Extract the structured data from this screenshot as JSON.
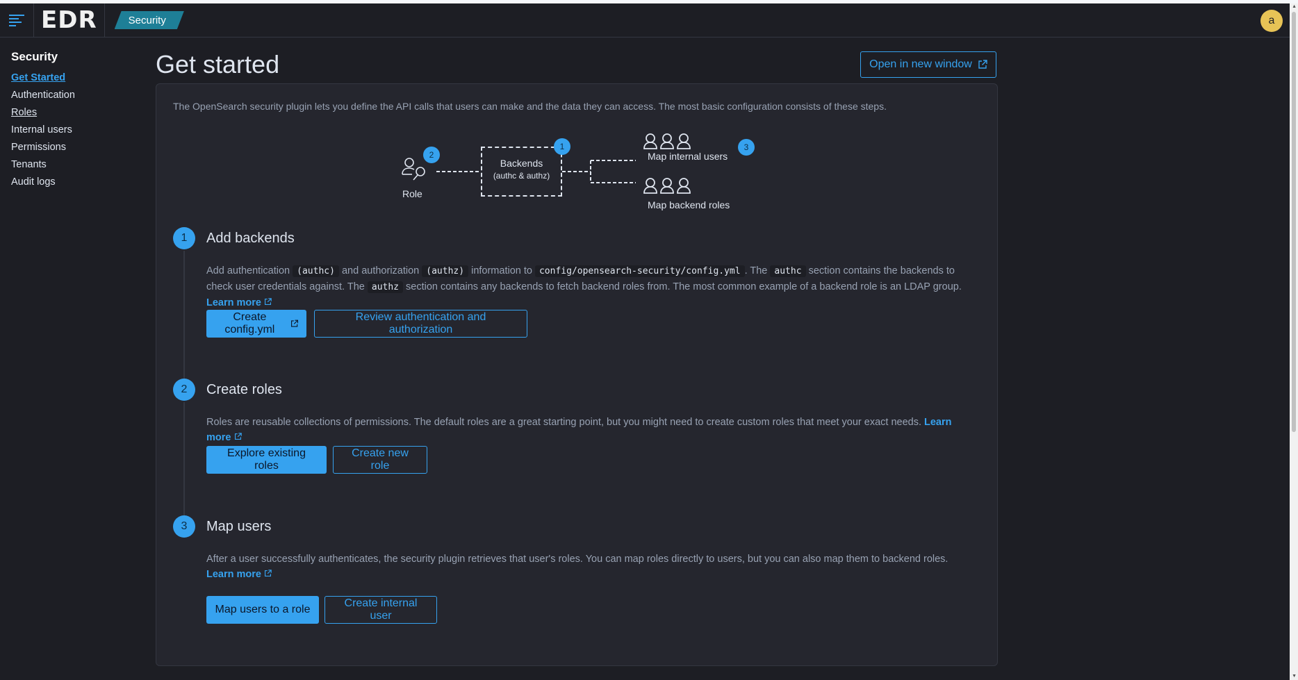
{
  "header": {
    "logo": "EDR",
    "breadcrumb": "Security",
    "avatar_initial": "a"
  },
  "sidebar": {
    "title": "Security",
    "items": [
      {
        "label": "Get Started"
      },
      {
        "label": "Authentication"
      },
      {
        "label": "Roles"
      },
      {
        "label": "Internal users"
      },
      {
        "label": "Permissions"
      },
      {
        "label": "Tenants"
      },
      {
        "label": "Audit logs"
      }
    ]
  },
  "main": {
    "title": "Get started",
    "open_window_label": "Open in new window",
    "intro": "The OpenSearch security plugin lets you define the API calls that users can make and the data they can access. The most basic configuration consists of these steps."
  },
  "diagram": {
    "role_label": "Role",
    "role_badge": "2",
    "backends_label": "Backends",
    "backends_sub": "(authc & authz)",
    "backends_badge": "1",
    "map_internal_label": "Map internal users",
    "map_badge": "3",
    "map_backend_label": "Map backend roles"
  },
  "steps": [
    {
      "number": "1",
      "title": "Add backends",
      "text": {
        "p1": "Add authentication",
        "c1": "(authc)",
        "p2": "and authorization",
        "c2": "(authz)",
        "p3": "information to",
        "c3": "config/opensearch-security/config.yml",
        "p4": ". The",
        "c4": "authc",
        "p5": "section contains the backends to check user credentials against. The",
        "c5": "authz",
        "p6": "section contains any backends to fetch backend roles from. The most common example of a backend role is an LDAP group.",
        "learn": "Learn more"
      },
      "primary": "Create config.yml",
      "secondary": "Review authentication and authorization"
    },
    {
      "number": "2",
      "title": "Create roles",
      "text": "Roles are reusable collections of permissions. The default roles are a great starting point, but you might need to create custom roles that meet your exact needs.",
      "learn": "Learn more",
      "primary": "Explore existing roles",
      "secondary": "Create new role"
    },
    {
      "number": "3",
      "title": "Map users",
      "text": "After a user successfully authenticates, the security plugin retrieves that user's roles. You can map roles directly to users, but you can also map them to backend roles.",
      "learn": "Learn more",
      "primary": "Map users to a role",
      "secondary": "Create internal user"
    }
  ],
  "colors": {
    "accent": "#36a2ef",
    "background": "#1d1e24",
    "panel": "#25262e",
    "breadcrumb": "#1e7f97",
    "avatar": "#e7c356"
  },
  "icons": [
    "menu-icon",
    "external-link-icon",
    "role-icon",
    "user-icon"
  ]
}
